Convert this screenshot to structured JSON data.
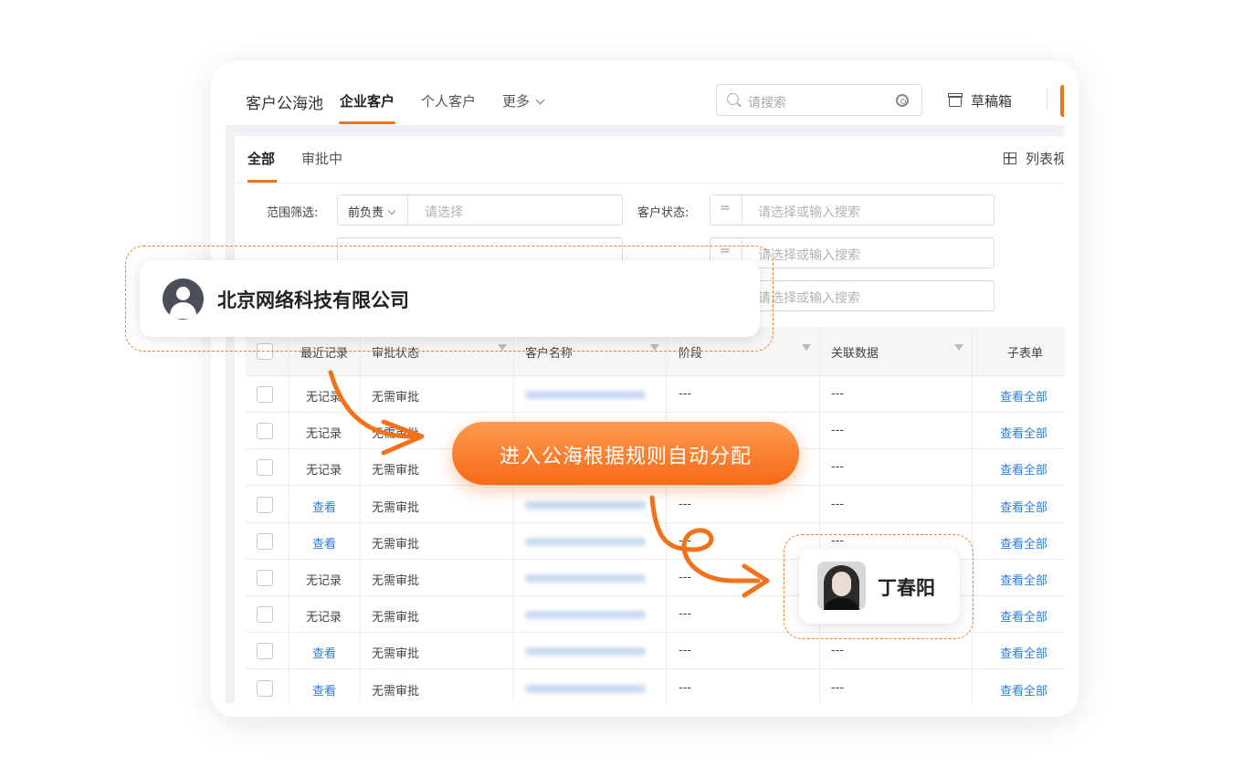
{
  "nav": {
    "title": "客户公海池",
    "tabs": [
      {
        "label": "企业客户",
        "active": true
      },
      {
        "label": "个人客户",
        "active": false
      },
      {
        "label": "更多",
        "active": false
      }
    ],
    "search_placeholder": "请搜索",
    "draft_label": "草稿箱"
  },
  "subtabs": [
    {
      "label": "全部",
      "active": true
    },
    {
      "label": "审批中",
      "active": false
    }
  ],
  "list_view_label": "列表视",
  "filters": {
    "scope_label": "范围筛选:",
    "scope_prefix": "前负责",
    "scope_placeholder": "请选择",
    "status_label": "客户状态:",
    "eq_symbol": "=",
    "status_placeholder": "请选择或输入搜索",
    "row2_placeholder": "请选择或输入搜索",
    "row3_placeholder": "请选择或输入搜索"
  },
  "table": {
    "headers": [
      "最近记录",
      "审批状态",
      "客户名称",
      "阶段",
      "关联数据",
      "子表单"
    ],
    "rows": [
      {
        "recent": "无记录",
        "recent_link": false,
        "approval": "无需审批",
        "stage": "---",
        "related": "---",
        "sub": "查看全部"
      },
      {
        "recent": "无记录",
        "recent_link": false,
        "approval": "无需审批",
        "stage": "---",
        "related": "---",
        "sub": "查看全部"
      },
      {
        "recent": "无记录",
        "recent_link": false,
        "approval": "无需审批",
        "stage": "---",
        "related": "---",
        "sub": "查看全部"
      },
      {
        "recent": "查看",
        "recent_link": true,
        "approval": "无需审批",
        "stage": "---",
        "related": "---",
        "sub": "查看全部"
      },
      {
        "recent": "查看",
        "recent_link": true,
        "approval": "无需审批",
        "stage": "---",
        "related": "---",
        "sub": "查看全部"
      },
      {
        "recent": "无记录",
        "recent_link": false,
        "approval": "无需审批",
        "stage": "---",
        "related": "---",
        "sub": "查看全部"
      },
      {
        "recent": "无记录",
        "recent_link": false,
        "approval": "无需审批",
        "stage": "---",
        "related": "---",
        "sub": "查看全部"
      },
      {
        "recent": "查看",
        "recent_link": true,
        "approval": "无需审批",
        "stage": "---",
        "related": "---",
        "sub": "查看全部"
      },
      {
        "recent": "查看",
        "recent_link": true,
        "approval": "无需审批",
        "stage": "---",
        "related": "---",
        "sub": "查看全部"
      }
    ]
  },
  "overlay": {
    "company_name": "北京网络科技有限公司",
    "action_label": "进入公海根据规则自动分配",
    "person_name": "丁春阳"
  },
  "colors": {
    "accent": "#f2721c",
    "link": "#2e7bea"
  }
}
